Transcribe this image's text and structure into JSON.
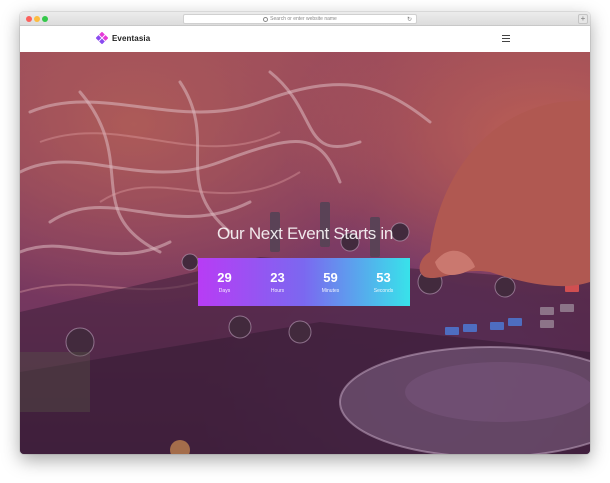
{
  "browser": {
    "url_placeholder": "Search or enter website name",
    "reload_icon": "↻",
    "newtab_icon": "+"
  },
  "brand": {
    "name": "Eventasia",
    "colors": {
      "logo_pink": "#e63bd8",
      "logo_purple": "#8a4af0"
    }
  },
  "hero": {
    "title": "Our Next Event Starts in",
    "countdown": [
      {
        "value": "29",
        "label": "Days"
      },
      {
        "value": "23",
        "label": "Hours"
      },
      {
        "value": "59",
        "label": "Minutes"
      },
      {
        "value": "53",
        "label": "Seconds"
      }
    ],
    "gradient": {
      "start": "#b83cf5",
      "end": "#38e2ea"
    }
  }
}
